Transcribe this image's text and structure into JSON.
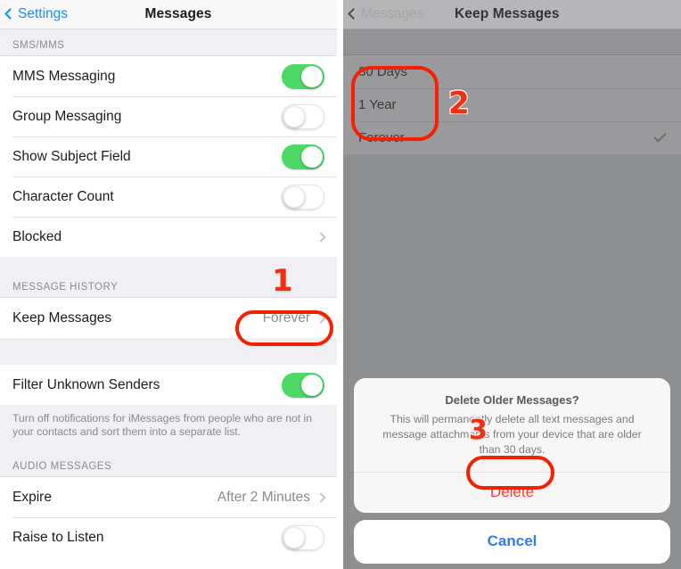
{
  "left_panel": {
    "nav": {
      "back_label": "Settings",
      "title": "Messages"
    },
    "sections": [
      {
        "header": "SMS/MMS",
        "rows": [
          {
            "label": "MMS Messaging",
            "control": "toggle",
            "state": "on"
          },
          {
            "label": "Group Messaging",
            "control": "toggle",
            "state": "off"
          },
          {
            "label": "Show Subject Field",
            "control": "toggle",
            "state": "on"
          },
          {
            "label": "Character Count",
            "control": "toggle",
            "state": "off"
          },
          {
            "label": "Blocked",
            "control": "chevron",
            "value": ""
          }
        ]
      },
      {
        "header": "MESSAGE HISTORY",
        "rows": [
          {
            "label": "Keep Messages",
            "control": "chevron",
            "value": "Forever"
          }
        ]
      },
      {
        "header": "",
        "rows": [
          {
            "label": "Filter Unknown Senders",
            "control": "toggle",
            "state": "on"
          }
        ],
        "note": "Turn off notifications for iMessages from people who are not in your contacts and sort them into a separate list."
      },
      {
        "header": "AUDIO MESSAGES",
        "rows": [
          {
            "label": "Expire",
            "control": "chevron",
            "value": "After 2 Minutes"
          },
          {
            "label": "Raise to Listen",
            "control": "toggle",
            "state": "off"
          }
        ]
      }
    ]
  },
  "right_panel": {
    "nav": {
      "back_label": "Messages",
      "title": "Keep Messages"
    },
    "options": [
      {
        "label": "30 Days",
        "selected": false
      },
      {
        "label": "1 Year",
        "selected": false
      },
      {
        "label": "Forever",
        "selected": true
      }
    ],
    "alert": {
      "title": "Delete Older Messages?",
      "message": "This will permanently delete all text messages and message attachments from your device that are older than 30 days.",
      "confirm_label": "Delete",
      "cancel_label": "Cancel"
    }
  },
  "annotations": {
    "step1": "1",
    "step2": "2",
    "step3": "3",
    "marker_color": "#f03010",
    "highlight_color": "#f42000"
  }
}
